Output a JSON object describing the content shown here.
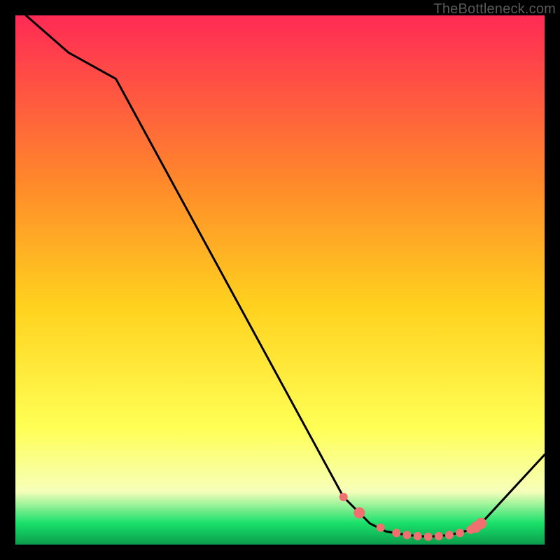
{
  "attribution": "TheBottleneck.com",
  "gradient_colors": {
    "top": "#ff2a55",
    "upper_mid": "#ff8a2a",
    "mid": "#ffd21e",
    "lower_mid": "#ffff55",
    "pale_band": "#f6ffba",
    "green": "#18e06a",
    "dark_green": "#0c9c4c"
  },
  "chart_data": {
    "type": "line",
    "title": "",
    "xlabel": "",
    "ylabel": "",
    "xlim": [
      0,
      100
    ],
    "ylim": [
      0,
      100
    ],
    "series": [
      {
        "name": "bottleneck-curve",
        "x": [
          2,
          10,
          19,
          62,
          67,
          70,
          74,
          78,
          82,
          86,
          88,
          100
        ],
        "y": [
          100,
          93,
          88,
          9,
          4,
          2.5,
          1.8,
          1.5,
          1.8,
          2.8,
          4,
          17
        ]
      }
    ],
    "markers": {
      "name": "highlight-dots",
      "x": [
        62,
        65,
        69,
        72,
        74,
        76,
        78,
        80,
        82,
        84,
        86,
        87,
        88
      ],
      "y": [
        9,
        6,
        3.2,
        2.2,
        1.8,
        1.6,
        1.5,
        1.6,
        1.8,
        2.2,
        2.8,
        3.3,
        4
      ],
      "radius": [
        6,
        8,
        6,
        6,
        6,
        6,
        6,
        6,
        6,
        6,
        6,
        8,
        8
      ]
    }
  }
}
